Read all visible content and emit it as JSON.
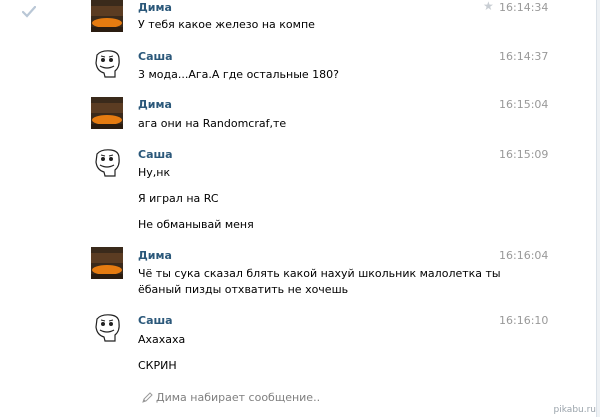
{
  "messages": [
    {
      "author": "Дима",
      "time": "16:14:34",
      "avatar": "dima-avatar",
      "lines": [
        "У тебя какое железо на компе"
      ]
    },
    {
      "author": "Саша",
      "time": "16:14:37",
      "avatar": "sasha-avatar",
      "lines": [
        "3 мода...Ага.А где остальные 180?"
      ]
    },
    {
      "author": "Дима",
      "time": "16:15:04",
      "avatar": "dima-avatar",
      "lines": [
        "ага они на Randomcraf,те"
      ]
    },
    {
      "author": "Саша",
      "time": "16:15:09",
      "avatar": "sasha-avatar",
      "lines": [
        "Ну,нк",
        "Я играл на RC",
        "Не обманывай меня"
      ]
    },
    {
      "author": "Дима",
      "time": "16:16:04",
      "avatar": "dima-avatar",
      "lines": [
        "Чё ты сука сказал блять какой нахуй школьник малолетка ты",
        "ёбаный пизды отхватить не хочешь"
      ]
    },
    {
      "author": "Саша",
      "time": "16:16:10",
      "avatar": "sasha-avatar",
      "lines": [
        "Ахахаха",
        "СКРИН"
      ]
    }
  ],
  "typing_indicator": "Дима набирает сообщение..",
  "watermark": "pikabu.ru",
  "colors": {
    "author_name": "#2b587a",
    "timestamp": "#999999",
    "typing": "#808080",
    "check": "#b9c7d6"
  },
  "icons": {
    "read_check": "check-icon",
    "important_star": "star-icon",
    "typing": "pencil-icon"
  }
}
